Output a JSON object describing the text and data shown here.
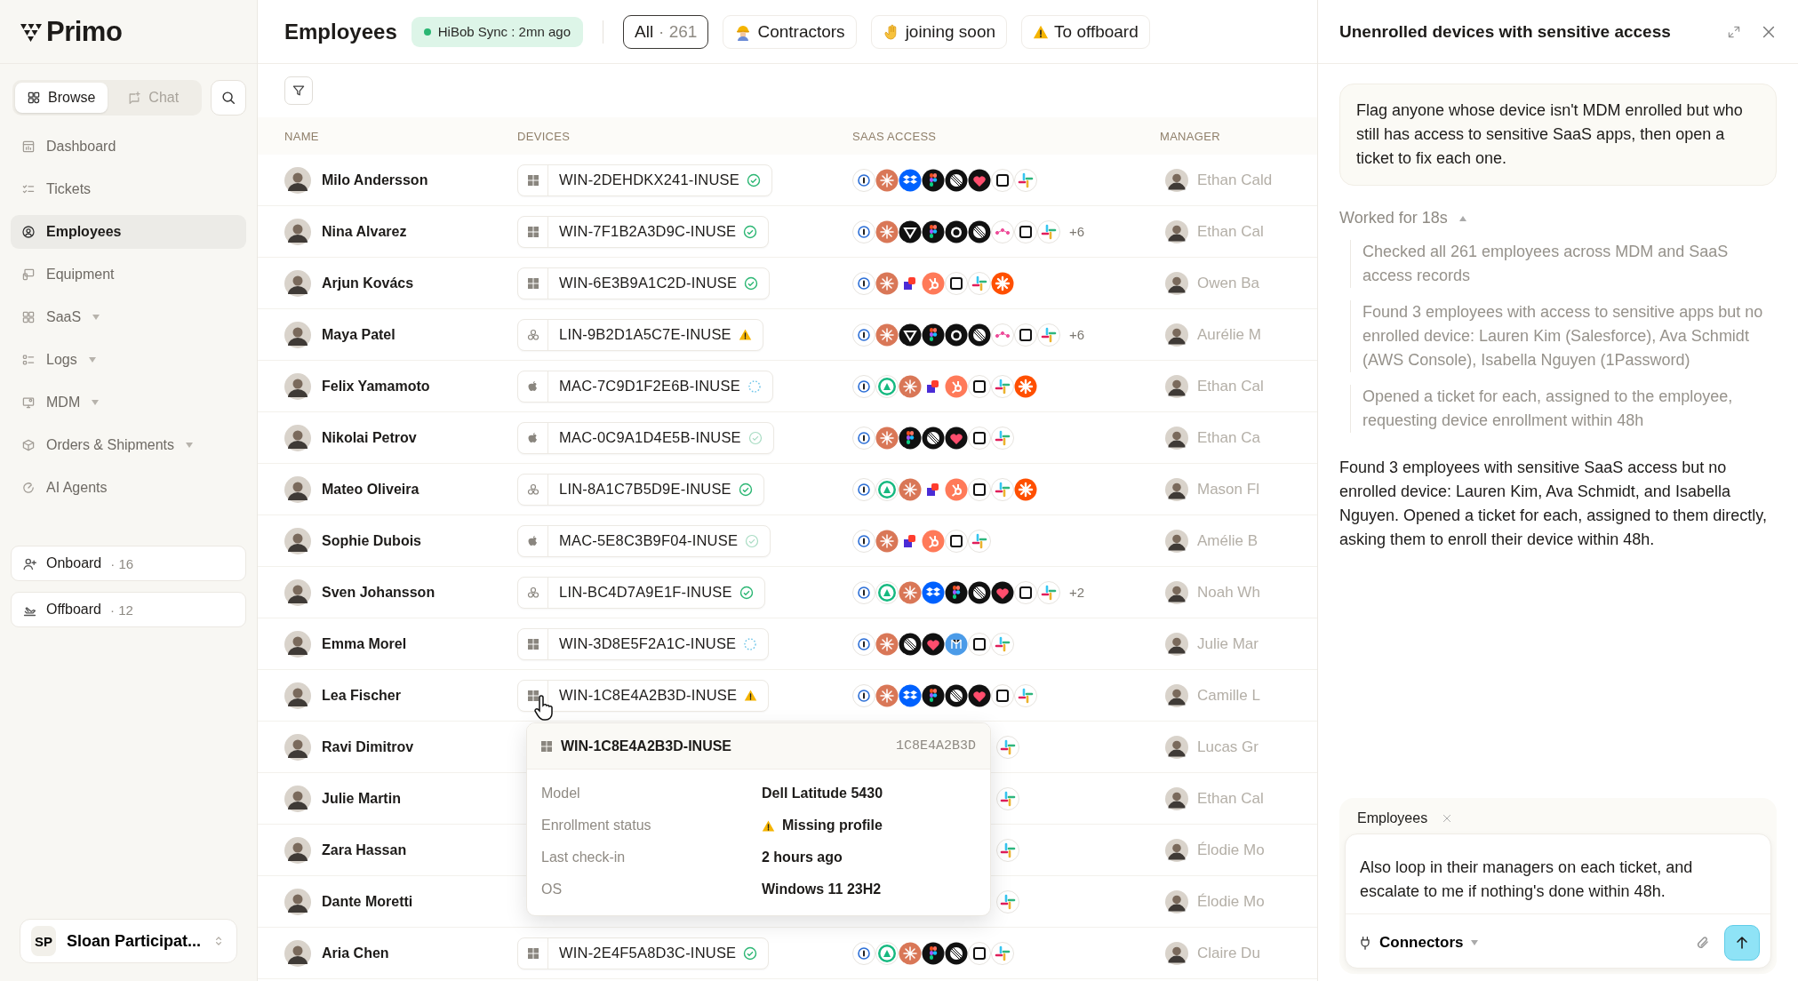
{
  "sidebar": {
    "logo": "Primo",
    "mode_tabs": [
      {
        "label": "Browse",
        "selected": true
      },
      {
        "label": "Chat",
        "selected": false
      }
    ],
    "nav": [
      {
        "label": "Dashboard",
        "has_menu": false,
        "selected": false
      },
      {
        "label": "Tickets",
        "has_menu": false,
        "selected": false
      },
      {
        "label": "Employees",
        "has_menu": false,
        "selected": true
      },
      {
        "label": "Equipment",
        "has_menu": false,
        "selected": false
      },
      {
        "label": "SaaS",
        "has_menu": true,
        "selected": false
      },
      {
        "label": "Logs",
        "has_menu": true,
        "selected": false
      },
      {
        "label": "MDM",
        "has_menu": true,
        "selected": false
      },
      {
        "label": "Orders & Shipments",
        "has_menu": true,
        "selected": false
      },
      {
        "label": "AI Agents",
        "has_menu": false,
        "selected": false
      }
    ],
    "shortcuts": [
      {
        "label": "Onboard",
        "count": "· 16"
      },
      {
        "label": "Offboard",
        "count": "· 12"
      }
    ],
    "user": {
      "initials": "SP",
      "name": "Sloan Participat..."
    }
  },
  "header": {
    "title": "Employees",
    "sync": "HiBob Sync : 2mn ago",
    "filters": [
      {
        "label": "All",
        "count": "· 261",
        "selected": true
      },
      {
        "label": "Contractors",
        "selected": false
      },
      {
        "label": "joining soon",
        "selected": false
      },
      {
        "label": "To offboard",
        "selected": false
      }
    ]
  },
  "table": {
    "columns": [
      "NAME",
      "DEVICES",
      "SAAS ACCESS",
      "MANAGER"
    ],
    "rows": [
      {
        "name": "Milo Andersson",
        "device": {
          "kind": "windows",
          "id": "WIN-2DEHDKX241-INUSE",
          "badge": {
            "kind": "verified"
          }
        },
        "saas": [
          {
            "kind": "key"
          },
          {
            "kind": "asterisk"
          },
          {
            "kind": "diamond"
          },
          {
            "kind": "dots"
          },
          {
            "kind": "stripes"
          },
          {
            "kind": "heart"
          },
          {
            "kind": "square"
          },
          {
            "kind": "pinwheel"
          }
        ],
        "manager": "Ethan Cald"
      },
      {
        "name": "Nina Alvarez",
        "device": {
          "kind": "windows",
          "id": "WIN-7F1B2A3D9C-INUSE",
          "badge": {
            "kind": "verified"
          }
        },
        "saas": [
          {
            "kind": "key"
          },
          {
            "kind": "asterisk"
          },
          {
            "kind": "triangle"
          },
          {
            "kind": "dots"
          },
          {
            "kind": "blob"
          },
          {
            "kind": "stripes"
          },
          {
            "kind": "nodes"
          },
          {
            "kind": "square"
          },
          {
            "kind": "pinwheel"
          }
        ],
        "more": "+6",
        "manager": "Ethan Cal"
      },
      {
        "name": "Arjun Kovács",
        "device": {
          "kind": "windows",
          "id": "WIN-6E3B9A1C2D-INUSE",
          "badge": {
            "kind": "verified"
          }
        },
        "saas": [
          {
            "kind": "key"
          },
          {
            "kind": "asterisk"
          },
          {
            "kind": "blocks"
          },
          {
            "kind": "sprocket"
          },
          {
            "kind": "square"
          },
          {
            "kind": "pinwheel"
          },
          {
            "kind": "burst"
          }
        ],
        "manager": "Owen Ba"
      },
      {
        "name": "Maya Patel",
        "device": {
          "kind": "linux",
          "id": "LIN-9B2D1A5C7E-INUSE",
          "badge": {
            "kind": "warning"
          }
        },
        "saas": [
          {
            "kind": "key"
          },
          {
            "kind": "asterisk"
          },
          {
            "kind": "triangle"
          },
          {
            "kind": "dots"
          },
          {
            "kind": "blob"
          },
          {
            "kind": "stripes"
          },
          {
            "kind": "nodes"
          },
          {
            "kind": "square"
          },
          {
            "kind": "pinwheel"
          }
        ],
        "more": "+6",
        "manager": "Aurélie M"
      },
      {
        "name": "Felix Yamamoto",
        "device": {
          "kind": "mac",
          "id": "MAC-7C9D1F2E6B-INUSE",
          "badge": {
            "kind": "pending"
          }
        },
        "saas": [
          {
            "kind": "key"
          },
          {
            "kind": "ring"
          },
          {
            "kind": "asterisk"
          },
          {
            "kind": "blocks"
          },
          {
            "kind": "sprocket"
          },
          {
            "kind": "square"
          },
          {
            "kind": "pinwheel"
          },
          {
            "kind": "burst"
          }
        ],
        "manager": "Ethan Cal"
      },
      {
        "name": "Nikolai Petrov",
        "device": {
          "kind": "mac",
          "id": "MAC-0C9A1D4E5B-INUSE",
          "badge": {
            "kind": "stale"
          }
        },
        "saas": [
          {
            "kind": "key"
          },
          {
            "kind": "asterisk"
          },
          {
            "kind": "dots"
          },
          {
            "kind": "stripes"
          },
          {
            "kind": "heart"
          },
          {
            "kind": "square"
          },
          {
            "kind": "pinwheel"
          }
        ],
        "manager": "Ethan Ca"
      },
      {
        "name": "Mateo Oliveira",
        "device": {
          "kind": "linux",
          "id": "LIN-8A1C7B5D9E-INUSE",
          "badge": {
            "kind": "verified"
          }
        },
        "saas": [
          {
            "kind": "key"
          },
          {
            "kind": "ring"
          },
          {
            "kind": "asterisk"
          },
          {
            "kind": "blocks"
          },
          {
            "kind": "sprocket"
          },
          {
            "kind": "square"
          },
          {
            "kind": "pinwheel"
          },
          {
            "kind": "burst"
          }
        ],
        "manager": "Mason Fl"
      },
      {
        "name": "Sophie Dubois",
        "device": {
          "kind": "mac",
          "id": "MAC-5E8C3B9F04-INUSE",
          "badge": {
            "kind": "stale"
          }
        },
        "saas": [
          {
            "kind": "key"
          },
          {
            "kind": "asterisk"
          },
          {
            "kind": "blocks"
          },
          {
            "kind": "sprocket"
          },
          {
            "kind": "square"
          },
          {
            "kind": "pinwheel"
          }
        ],
        "manager": "Amélie B"
      },
      {
        "name": "Sven Johansson",
        "device": {
          "kind": "linux",
          "id": "LIN-BC4D7A9E1F-INUSE",
          "badge": {
            "kind": "verified"
          }
        },
        "saas": [
          {
            "kind": "key"
          },
          {
            "kind": "ring"
          },
          {
            "kind": "asterisk"
          },
          {
            "kind": "diamond"
          },
          {
            "kind": "dots"
          },
          {
            "kind": "stripes"
          },
          {
            "kind": "heart"
          },
          {
            "kind": "square"
          },
          {
            "kind": "pinwheel"
          }
        ],
        "more": "+2",
        "manager": "Noah Wh"
      },
      {
        "name": "Emma Morel",
        "device": {
          "kind": "windows",
          "id": "WIN-3D8E5F2A1C-INUSE",
          "badge": {
            "kind": "pending"
          }
        },
        "saas": [
          {
            "kind": "key"
          },
          {
            "kind": "asterisk"
          },
          {
            "kind": "stripes"
          },
          {
            "kind": "heart"
          },
          {
            "kind": "grid"
          },
          {
            "kind": "square"
          },
          {
            "kind": "pinwheel"
          }
        ],
        "manager": "Julie Mar"
      },
      {
        "name": "Lea Fischer",
        "device": {
          "kind": "windows",
          "id": "WIN-1C8E4A2B3D-INUSE",
          "badge": {
            "kind": "warning"
          }
        },
        "saas": [
          {
            "kind": "key"
          },
          {
            "kind": "asterisk"
          },
          {
            "kind": "diamond"
          },
          {
            "kind": "dots"
          },
          {
            "kind": "stripes"
          },
          {
            "kind": "heart"
          },
          {
            "kind": "square"
          },
          {
            "kind": "pinwheel"
          }
        ],
        "manager": "Camille L",
        "popover": {
          "title": "WIN-1C8E4A2B3D-INUSE",
          "serial": "1C8E4A2B3D",
          "fields": [
            {
              "label": "Model",
              "value": "Dell Latitude 5430",
              "flag": false
            },
            {
              "label": "Enrollment status",
              "value": "Missing profile",
              "flag": true
            },
            {
              "label": "Last check-in",
              "value": "2 hours ago",
              "flag": false
            },
            {
              "label": "OS",
              "value": "Windows 11 23H2",
              "flag": false
            }
          ]
        }
      },
      {
        "name": "Ravi Dimitrov",
        "saas": [
          {
            "kind": "pinwheel"
          }
        ],
        "manager": "Lucas Gr"
      },
      {
        "name": "Julie Martin",
        "saas": [
          {
            "kind": "pinwheel"
          }
        ],
        "manager": "Ethan Cal"
      },
      {
        "name": "Zara Hassan",
        "saas": [
          {
            "kind": "pinwheel"
          }
        ],
        "manager": "Élodie Mo"
      },
      {
        "name": "Dante Moretti",
        "saas": [
          {
            "kind": "pinwheel"
          }
        ],
        "manager": "Élodie Mo"
      },
      {
        "name": "Aria Chen",
        "device": {
          "kind": "windows",
          "id": "WIN-2E4F5A8D3C-INUSE",
          "badge": {
            "kind": "verified"
          }
        },
        "saas": [
          {
            "kind": "key"
          },
          {
            "kind": "ring"
          },
          {
            "kind": "asterisk"
          },
          {
            "kind": "dots"
          },
          {
            "kind": "stripes"
          },
          {
            "kind": "square"
          },
          {
            "kind": "pinwheel"
          }
        ],
        "manager": "Claire Du"
      }
    ]
  },
  "panel": {
    "title": "Unenrolled devices with sensitive access",
    "prompt": "Flag anyone whose device isn't MDM enrolled but who still has access to sensitive SaaS apps, then open a ticket to fix each one.",
    "worked": "Worked for 18s",
    "expanded": true,
    "steps": [
      "Checked all 261 employees across MDM and SaaS access records",
      "Found 3 employees with access to sensitive apps but no enrolled device: Lauren Kim (Salesforce), Ava Schmidt (AWS Console), Isabella Nguyen (1Password)",
      "Opened a ticket for each, assigned to the employee, requesting device enrollment within 48h"
    ],
    "answer": "Found 3 employees with sensitive SaaS access but no enrolled device: Lauren Kim, Ava Schmidt, and Isabella Nguyen. Opened a ticket for each, assigned to them directly, asking them to enroll their device within 48h.",
    "composer": {
      "context": "Employees",
      "value": "Also loop in their managers on each ticket, and escalate to me if nothing's done within 48h.",
      "connectors": "Connectors"
    }
  }
}
